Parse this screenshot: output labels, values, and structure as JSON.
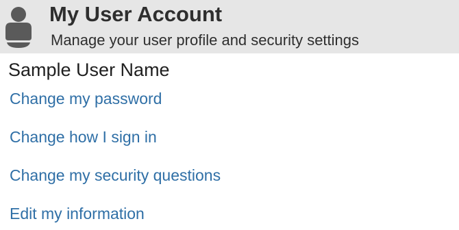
{
  "header": {
    "title": "My User Account",
    "subtitle": "Manage your user profile and security settings",
    "icon": "user-silhouette-icon",
    "background_color": "#e6e6e6"
  },
  "user": {
    "name": "Sample User Name"
  },
  "links": [
    {
      "label": "Change my password"
    },
    {
      "label": "Change how I sign in"
    },
    {
      "label": "Change my security questions"
    },
    {
      "label": "Edit my information"
    }
  ],
  "colors": {
    "link": "#2f6fa6",
    "text": "#2e2e2e"
  }
}
